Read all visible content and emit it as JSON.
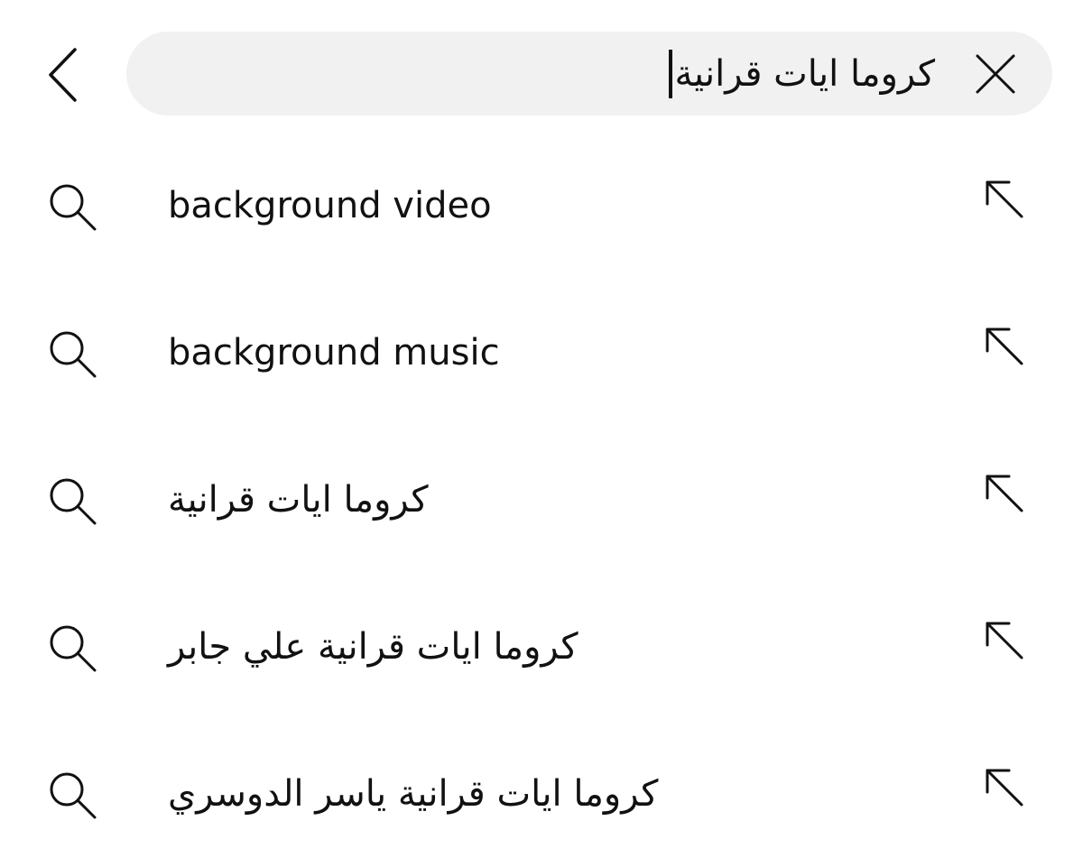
{
  "header": {
    "back_icon": "chevron-left-icon",
    "search": {
      "value": "كروما ايات قرانية",
      "clear_icon": "close-icon"
    }
  },
  "suggestions": [
    {
      "label": "background video",
      "dir": "ltr",
      "icon": "search-icon",
      "fill_icon": "arrow-up-left-icon"
    },
    {
      "label": "background music",
      "dir": "ltr",
      "icon": "search-icon",
      "fill_icon": "arrow-up-left-icon"
    },
    {
      "label": "كروما ايات قرانية",
      "dir": "rtl",
      "icon": "search-icon",
      "fill_icon": "arrow-up-left-icon"
    },
    {
      "label": "كروما ايات قرانية علي جابر",
      "dir": "rtl",
      "icon": "search-icon",
      "fill_icon": "arrow-up-left-icon"
    },
    {
      "label": "كروما ايات قرانية ياسر الدوسري",
      "dir": "rtl",
      "icon": "search-icon",
      "fill_icon": "arrow-up-left-icon"
    }
  ],
  "colors": {
    "search_background": "#f1f1f1",
    "text": "#111111",
    "icon": "#111111"
  }
}
